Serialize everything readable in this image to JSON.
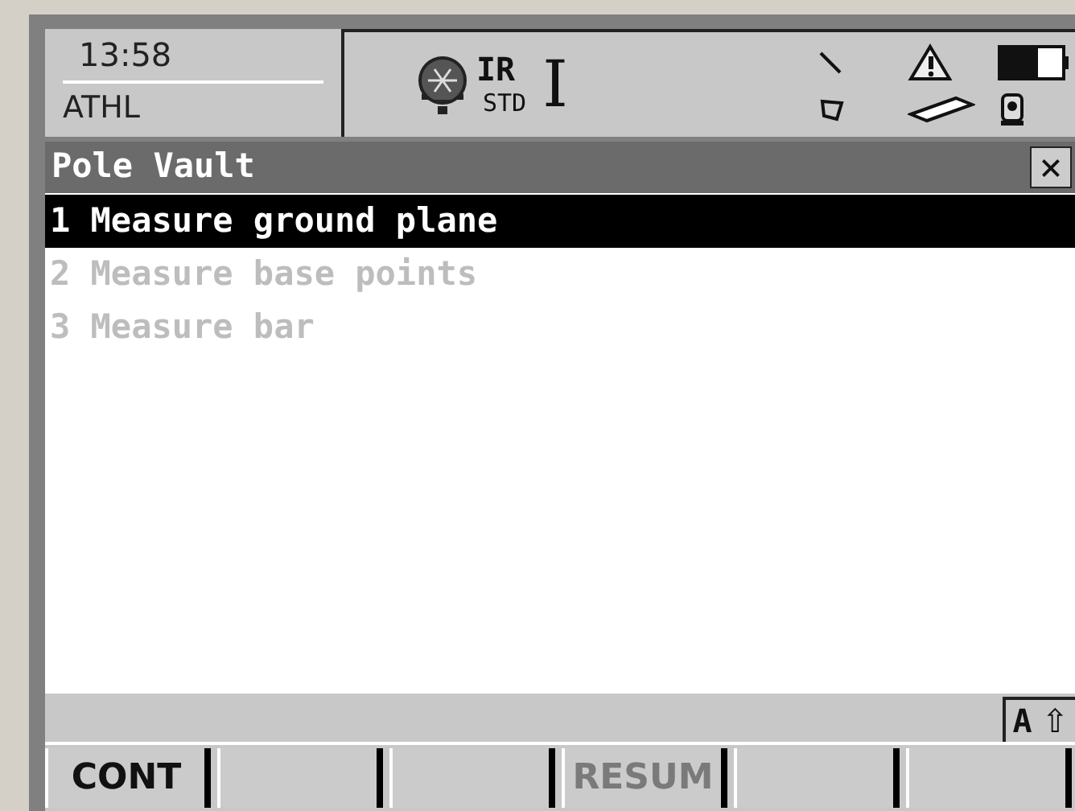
{
  "status": {
    "time": "13:58",
    "code": "ATHL",
    "mode": "IR",
    "mode_sub": "STD",
    "face": "I"
  },
  "window": {
    "title": "Pole Vault",
    "close": "×"
  },
  "items": [
    {
      "number": "1",
      "label": "Measure ground plane",
      "selected": true,
      "disabled": false
    },
    {
      "number": "2",
      "label": "Measure base points",
      "selected": false,
      "disabled": true
    },
    {
      "number": "3",
      "label": "Measure bar",
      "selected": false,
      "disabled": true
    }
  ],
  "input_mode": {
    "letter": "A",
    "shift": "⇧"
  },
  "softkeys": [
    {
      "kind": "key",
      "label": "CONT",
      "disabled": false
    },
    {
      "kind": "blank"
    },
    {
      "kind": "blank"
    },
    {
      "kind": "key",
      "label": "RESUM",
      "disabled": true
    },
    {
      "kind": "blank"
    },
    {
      "kind": "blank"
    }
  ]
}
